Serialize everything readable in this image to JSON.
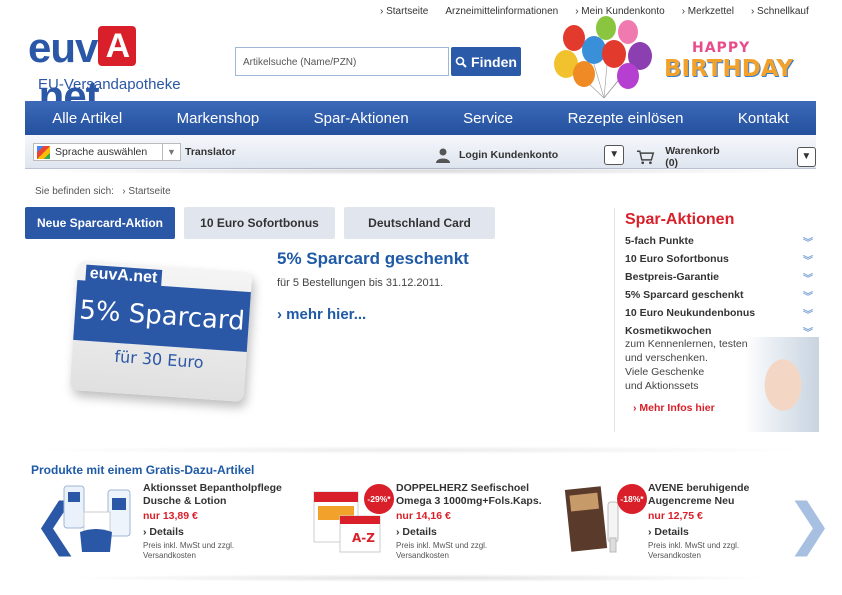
{
  "toplinks": [
    "› Startseite",
    "Arzneimittelinformationen",
    "› Mein Kundenkonto",
    "› Merkzettel",
    "› Schnellkauf"
  ],
  "logo": {
    "word_left": "euv",
    "word_a": "A",
    "word_right": ".net",
    "subtitle": "EU-Versandapotheke"
  },
  "search": {
    "placeholder": "Artikelsuche (Name/PZN)",
    "button": "Finden"
  },
  "birthday": {
    "line1": "HAPPY",
    "line2": "BIRTHDAY"
  },
  "nav": [
    "Alle Artikel",
    "Markenshop",
    "Spar-Aktionen",
    "Service",
    "Rezepte einlösen",
    "Kontakt"
  ],
  "subnav": {
    "language": "Sprache auswählen",
    "translator": "Translator",
    "login": "Login Kundenkonto",
    "cart": "Warenkorb (0)"
  },
  "breadcrumb": {
    "label": "Sie befinden sich:",
    "current": "› Startseite"
  },
  "tabs": [
    "Neue Sparcard-Aktion",
    "10 Euro Sofortbonus",
    "Deutschland Card"
  ],
  "promo": {
    "card_logo": "euvA.net",
    "card_main": "5% Sparcard",
    "card_sub": "für 30 Euro",
    "title": "5% Sparcard geschenkt",
    "text": "für 5 Bestellungen bis 31.12.2011.",
    "more": "› mehr hier..."
  },
  "spar": {
    "title": "Spar-Aktionen",
    "items": [
      "5-fach Punkte",
      "10 Euro Sofortbonus",
      "Bestpreis-Garantie",
      "5% Sparcard geschenkt",
      "10 Euro Neukundenbonus",
      "Kosmetikwochen"
    ],
    "desc": [
      "zum Kennenlernen, testen",
      "und verschenken.",
      "Viele Geschenke",
      "und Aktionssets"
    ],
    "more": "› Mehr Infos hier"
  },
  "products": {
    "heading": "Produkte mit einem Gratis-Dazu-Artikel",
    "details_label": "› Details",
    "note_line1": "Preis inkl. MwSt und zzgl.",
    "note_line2": "Versandkosten",
    "items": [
      {
        "name1": "Aktionsset Bepantholpflege",
        "name2": "Dusche & Lotion",
        "price": "nur 13,89 €",
        "badge": ""
      },
      {
        "name1": "DOPPELHERZ Seefischoel",
        "name2": "Omega 3 1000mg+Fols.Kaps.",
        "price": "nur 14,16 €",
        "badge": "-29%*"
      },
      {
        "name1": "AVENE beruhigende",
        "name2": "Augencreme Neu",
        "price": "nur 12,75 €",
        "badge": "-18%*"
      }
    ]
  },
  "colors": {
    "brand_blue": "#2a57a6",
    "accent_red": "#d9202a",
    "tab_grey": "#e1e6ee"
  }
}
